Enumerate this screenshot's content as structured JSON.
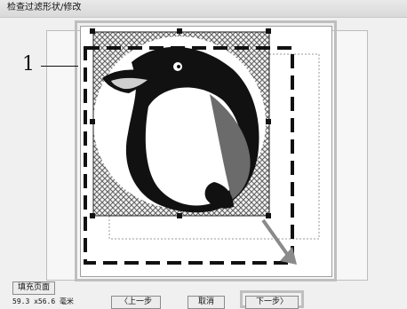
{
  "window": {
    "title": "检查过滤形状/修改"
  },
  "preview": {
    "callout": "1"
  },
  "footer": {
    "fill_page_label": "填充页面",
    "size_readout": "59.3 x56.6 毫米",
    "back_label": "〈上一步",
    "cancel_label": "取消",
    "next_label": "下一步〉"
  }
}
